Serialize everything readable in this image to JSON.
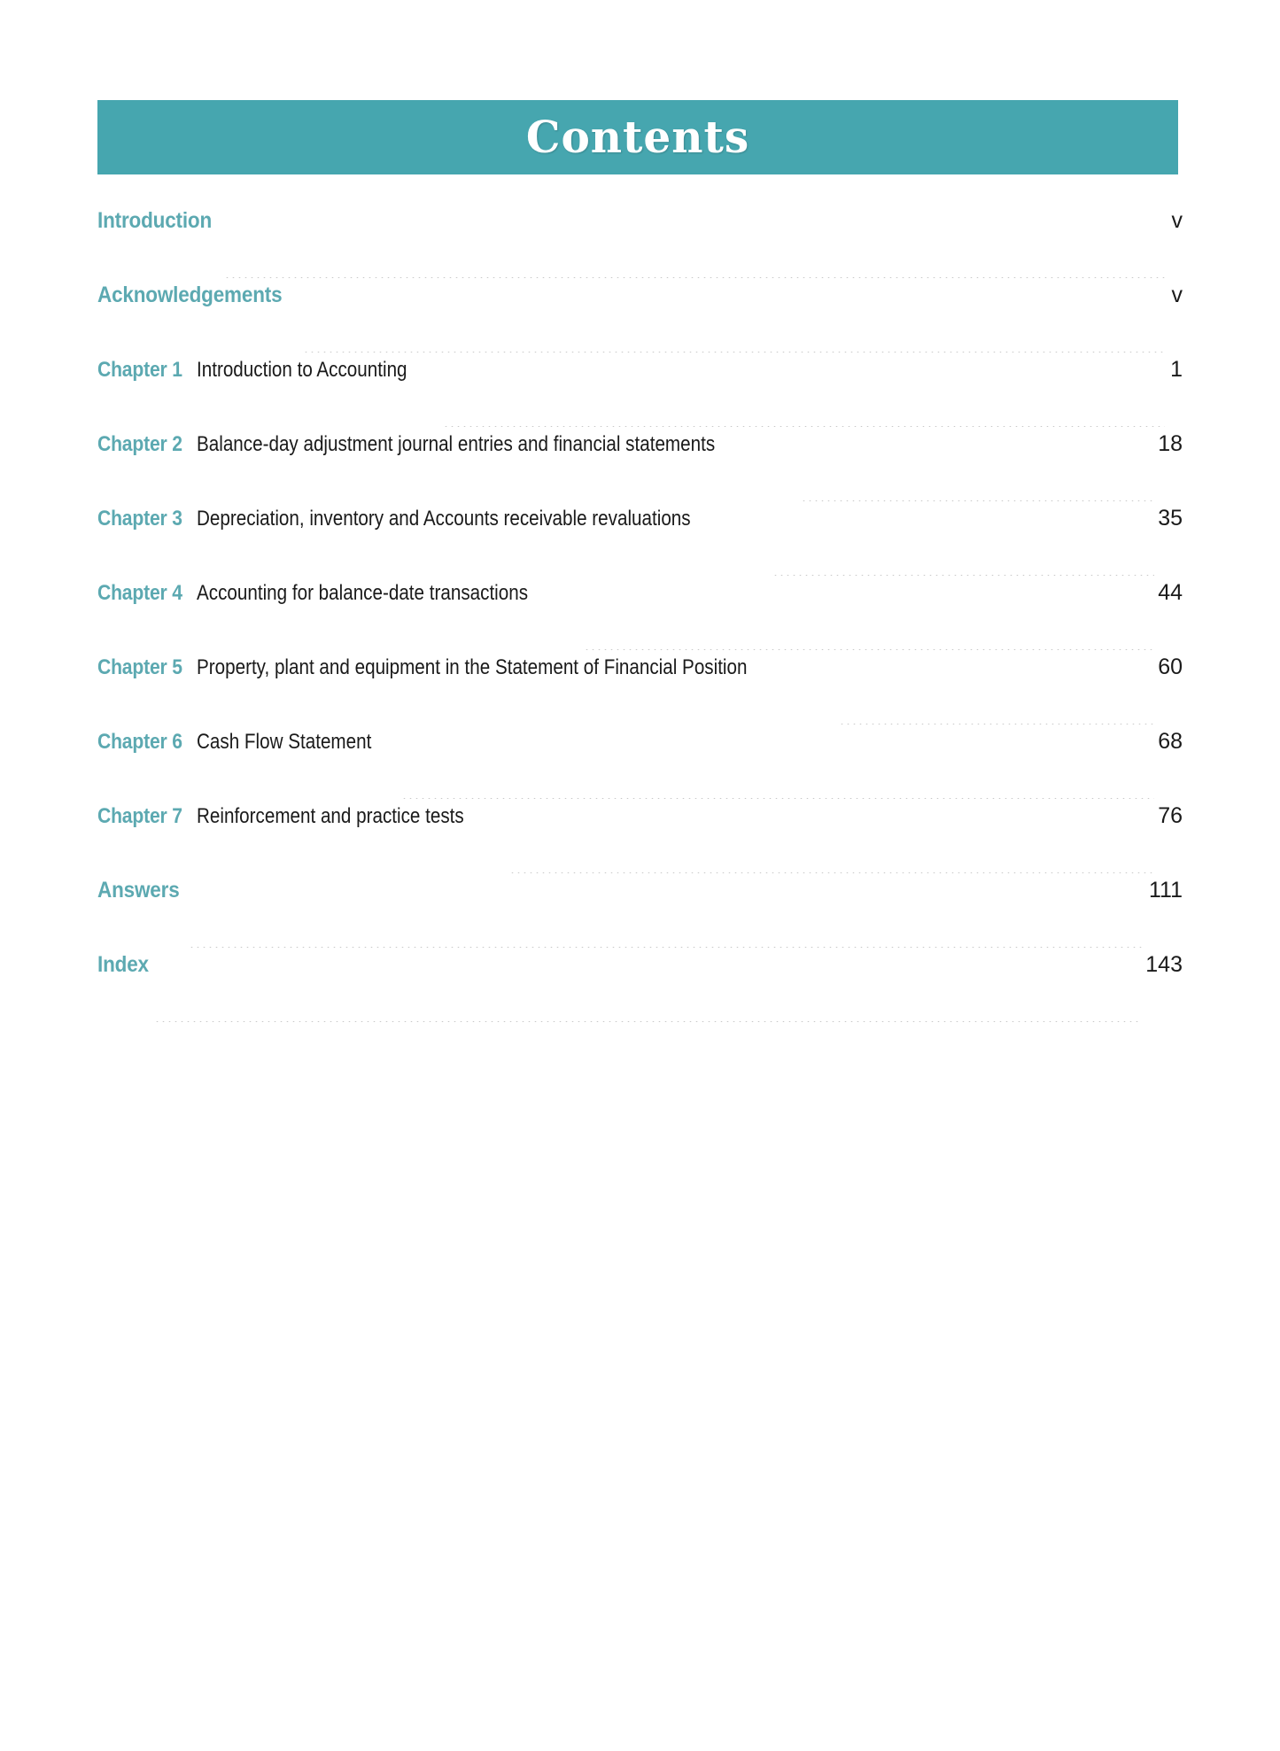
{
  "page": {
    "type": "table-of-contents",
    "background_color": "#ffffff"
  },
  "header": {
    "title": "Contents",
    "banner_color": "#46A6AF",
    "title_color": "#ffffff"
  },
  "theme": {
    "accent_teal": "#46A6AF",
    "heading_teal": "#5CA9B1",
    "body_text": "#1a1a1a",
    "leader_dot": "#c8c8c8"
  },
  "toc": {
    "entries": [
      {
        "kind": "section",
        "label": "Introduction",
        "chapter": "",
        "title": "",
        "page": "v"
      },
      {
        "kind": "section",
        "label": "Acknowledgements",
        "chapter": "",
        "title": "",
        "page": "v"
      },
      {
        "kind": "chapter",
        "label": "",
        "chapter": "Chapter 1",
        "title": "Introduction to Accounting",
        "page": "1"
      },
      {
        "kind": "chapter",
        "label": "",
        "chapter": "Chapter 2",
        "title": "Balance-day adjustment journal entries and financial statements",
        "page": "18"
      },
      {
        "kind": "chapter",
        "label": "",
        "chapter": "Chapter 3",
        "title": "Depreciation, inventory and Accounts receivable revaluations",
        "page": "35"
      },
      {
        "kind": "chapter",
        "label": "",
        "chapter": "Chapter 4",
        "title": "Accounting for balance-date transactions",
        "page": "44"
      },
      {
        "kind": "chapter",
        "label": "",
        "chapter": "Chapter 5",
        "title": "Property, plant and equipment in the Statement of Financial Position",
        "page": "60"
      },
      {
        "kind": "chapter",
        "label": "",
        "chapter": "Chapter 6",
        "title": "Cash Flow Statement",
        "page": "68"
      },
      {
        "kind": "chapter",
        "label": "",
        "chapter": "Chapter 7",
        "title": "Reinforcement and practice tests",
        "page": "76"
      },
      {
        "kind": "section",
        "label": "Answers",
        "chapter": "",
        "title": "",
        "page": "111"
      },
      {
        "kind": "section",
        "label": "Index",
        "chapter": "",
        "title": "",
        "page": "143"
      }
    ]
  }
}
